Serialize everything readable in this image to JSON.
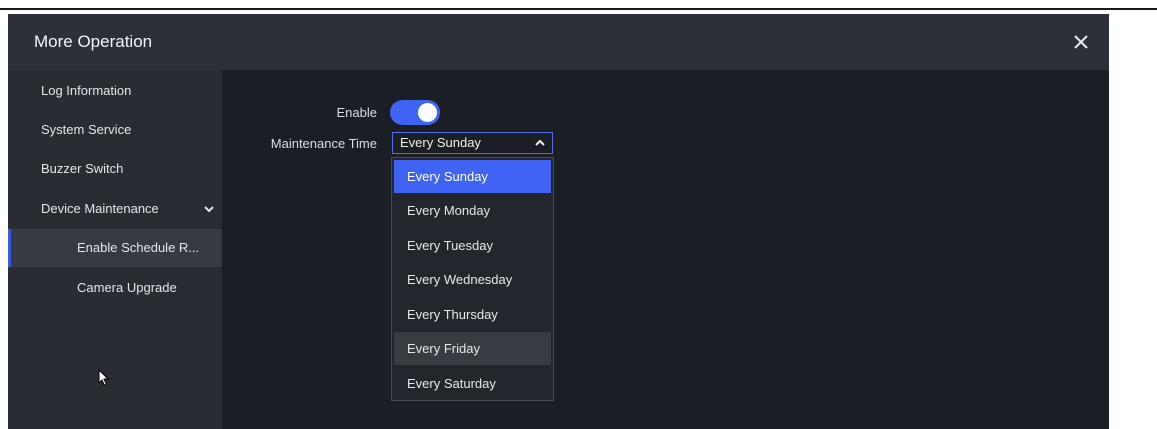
{
  "dialog": {
    "title": "More Operation",
    "close_icon": "close-icon"
  },
  "sidebar": {
    "items": [
      {
        "label": "Log Information"
      },
      {
        "label": "System Service"
      },
      {
        "label": "Buzzer Switch"
      },
      {
        "label": "Device Maintenance",
        "expanded": true,
        "icon": "chevron-down-icon"
      },
      {
        "label": "Enable Schedule R...",
        "selected": true
      },
      {
        "label": "Camera Upgrade"
      }
    ]
  },
  "form": {
    "enable_label": "Enable",
    "enable_on": true,
    "maintenance_label": "Maintenance Time",
    "maintenance_value": "Every Sunday",
    "dropdown_icon": "chevron-up-icon"
  },
  "dropdown": {
    "options": [
      {
        "label": "Every Sunday",
        "selected": true
      },
      {
        "label": "Every Monday"
      },
      {
        "label": "Every Tuesday"
      },
      {
        "label": "Every Wednesday"
      },
      {
        "label": "Every Thursday"
      },
      {
        "label": "Every Friday",
        "hovered": true
      },
      {
        "label": "Every Saturday"
      }
    ]
  },
  "colors": {
    "accent": "#3f63f2",
    "titlebar": "#2d3038",
    "sidebar": "#292c33",
    "content": "#1b1e25"
  }
}
